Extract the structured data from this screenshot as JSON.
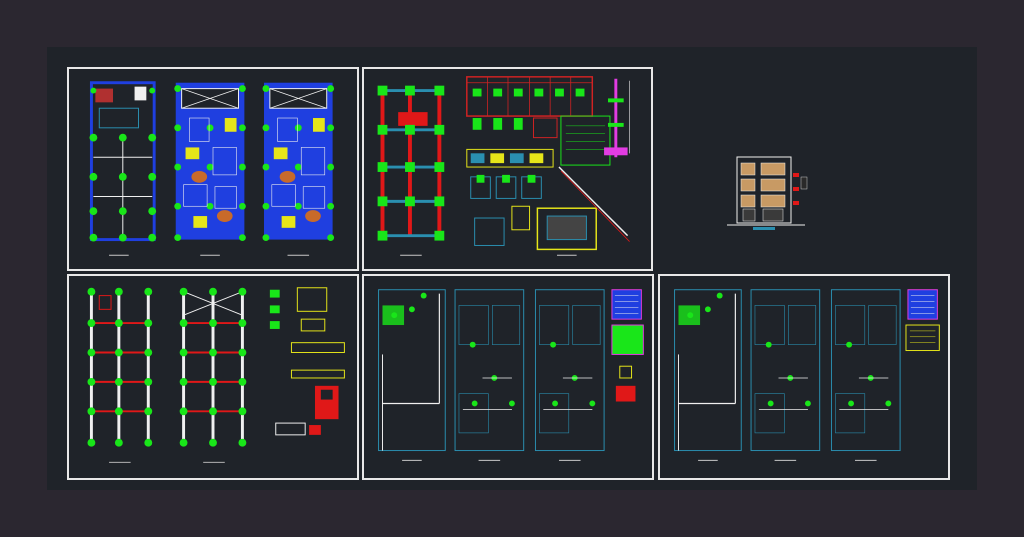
{
  "canvas": {
    "background": "#2b2730",
    "model_space": "#1f2329",
    "sheet_border": "#e8e8e8"
  },
  "palette": {
    "column": "#19e619",
    "slab_blue": "#1f3fe0",
    "beam_red": "#e01818",
    "wire_white": "#f0f0f0",
    "wall_blue": "#2a8fb0",
    "detail_yellow": "#e6e619",
    "pipe_magenta": "#e23ce2",
    "table_red": "#d12323"
  },
  "sheets": [
    {
      "id": "architecture",
      "content": "floor-plans"
    },
    {
      "id": "structure",
      "content": "foundation-and-details"
    },
    {
      "id": "framing",
      "content": "slab-framing-plans"
    },
    {
      "id": "sanitary-1",
      "content": "plumbing-plans"
    },
    {
      "id": "sanitary-2",
      "content": "plumbing-plans"
    }
  ],
  "elevation": {
    "content": "building-elevation",
    "floors": 4
  }
}
